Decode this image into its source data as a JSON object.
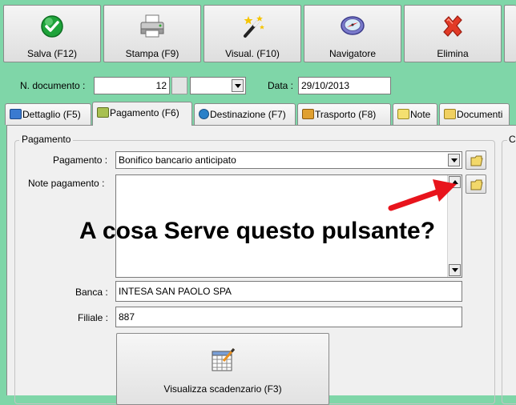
{
  "toolbar": {
    "save": "Salva (F12)",
    "print": "Stampa (F9)",
    "view": "Visual. (F10)",
    "navigator": "Navigatore",
    "delete": "Elimina"
  },
  "header": {
    "doc_number_label": "N. documento :",
    "doc_number_value": "12",
    "doc_series_value": "",
    "date_label": "Data :",
    "date_value": "29/10/2013"
  },
  "tabs": [
    {
      "label": "Dettaglio (F5)",
      "active": false
    },
    {
      "label": "Pagamento (F6)",
      "active": true
    },
    {
      "label": "Destinazione (F7)",
      "active": false
    },
    {
      "label": "Trasporto (F8)",
      "active": false
    },
    {
      "label": "Note",
      "active": false
    },
    {
      "label": "Documenti",
      "active": false
    }
  ],
  "payment": {
    "group_title": "Pagamento",
    "right_group_title": "C",
    "payment_label": "Pagamento :",
    "payment_value": "Bonifico bancario anticipato",
    "notes_label": "Note pagamento :",
    "notes_value": "",
    "bank_label": "Banca :",
    "bank_value": "INTESA SAN PAOLO SPA",
    "branch_label": "Filiale :",
    "branch_value": "887",
    "schedule_button": "Visualizza scadenzario (F3)"
  },
  "annotation": {
    "text": "A cosa Serve questo pulsante?",
    "arrow_color": "#e8141c"
  },
  "colors": {
    "background": "#7fd6a8",
    "panel": "#f0f0f0"
  }
}
